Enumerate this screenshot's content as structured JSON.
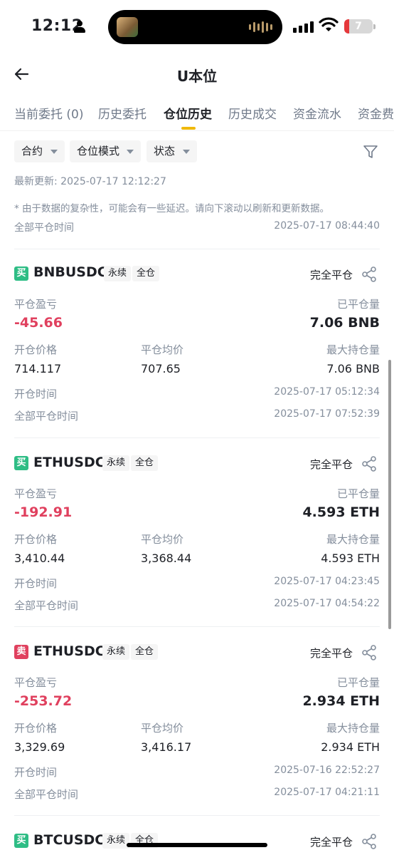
{
  "status_bar": {
    "time": "12:12",
    "battery": "7"
  },
  "header": {
    "title": "U本位"
  },
  "tabs": [
    {
      "label": "当前委托 (0)"
    },
    {
      "label": "历史委托"
    },
    {
      "label": "仓位历史"
    },
    {
      "label": "历史成交"
    },
    {
      "label": "资金流水"
    },
    {
      "label": "资金费"
    }
  ],
  "filters": {
    "contract": "合约",
    "position_mode": "仓位模式",
    "status": "状态"
  },
  "last_update": "最新更新: 2025-07-17 12:12:27",
  "notice": "* 由于数据的复杂性，可能会有一些延迟。请向下滚动以刷新和更新数据。",
  "top_row": {
    "label": "全部平仓时间",
    "value": "2025-07-17 08:44:40"
  },
  "labels": {
    "pnl": "平仓盈亏",
    "closed_qty": "已平仓量",
    "open_price": "开仓价格",
    "close_avg": "平仓均价",
    "max_qty": "最大持仓量",
    "open_time": "开仓时间",
    "close_time": "全部平仓时间"
  },
  "colors": {
    "buy": "#2ebd85",
    "sell": "#e0405e",
    "accent": "#f0b90b"
  },
  "positions": [
    {
      "side": "买",
      "symbol": "BNBUSDC",
      "type": "永续",
      "margin": "全仓",
      "status": "完全平仓",
      "pnl": "-45.66",
      "closed_qty": "7.06 BNB",
      "open_price": "714.117",
      "close_avg": "707.65",
      "max_qty": "7.06 BNB",
      "open_time": "2025-07-17 05:12:34",
      "close_time": "2025-07-17 07:52:39"
    },
    {
      "side": "买",
      "symbol": "ETHUSDC",
      "type": "永续",
      "margin": "全仓",
      "status": "完全平仓",
      "pnl": "-192.91",
      "closed_qty": "4.593 ETH",
      "open_price": "3,410.44",
      "close_avg": "3,368.44",
      "max_qty": "4.593 ETH",
      "open_time": "2025-07-17 04:23:45",
      "close_time": "2025-07-17 04:54:22"
    },
    {
      "side": "卖",
      "symbol": "ETHUSDC",
      "type": "永续",
      "margin": "全仓",
      "status": "完全平仓",
      "pnl": "-253.72",
      "closed_qty": "2.934 ETH",
      "open_price": "3,329.69",
      "close_avg": "3,416.17",
      "max_qty": "2.934 ETH",
      "open_time": "2025-07-16 22:52:27",
      "close_time": "2025-07-17 04:21:11"
    },
    {
      "side": "买",
      "symbol": "BTCUSDC",
      "type": "永续",
      "margin": "全仓",
      "status": "完全平仓"
    }
  ]
}
